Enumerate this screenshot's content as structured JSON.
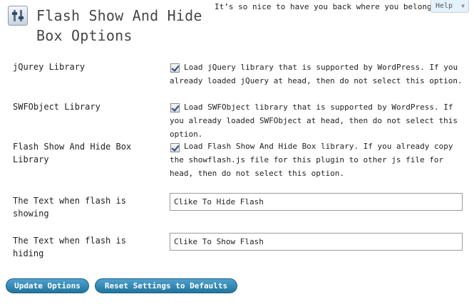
{
  "header": {
    "title": "Flash Show And Hide Box Options",
    "welcome": "It’s so nice to have you back where you belong",
    "help_label": "Help",
    "help_chevron": "▼",
    "icon": "settings-sliders-icon"
  },
  "rows": [
    {
      "label": "jQurey Library",
      "checked": true,
      "description": "Load jQuery library that is supported by WordPress. If you already loaded jQuery at head, then do not select this option."
    },
    {
      "label": "SWFObject Library",
      "checked": true,
      "description": "Load SWFObject library that is supported by WordPress. If you already loaded SWFObject at head, then do not select this option."
    },
    {
      "label": "Flash Show And Hide Box Library",
      "checked": true,
      "description": "Load Flash Show And Hide Box library. If you already copy the showflash.js file for this plugin to other js file for head, then do not select this option."
    },
    {
      "label": "The Text when flash is showing",
      "value": "Clike To Hide Flash"
    },
    {
      "label": "The Text when flash is hiding",
      "value": "Clike To Show Flash"
    }
  ],
  "buttons": {
    "update": "Update Options",
    "reset": "Reset Settings to Defaults"
  },
  "colors": {
    "button": "#21759b",
    "help_tab": "#e4f2fd"
  }
}
